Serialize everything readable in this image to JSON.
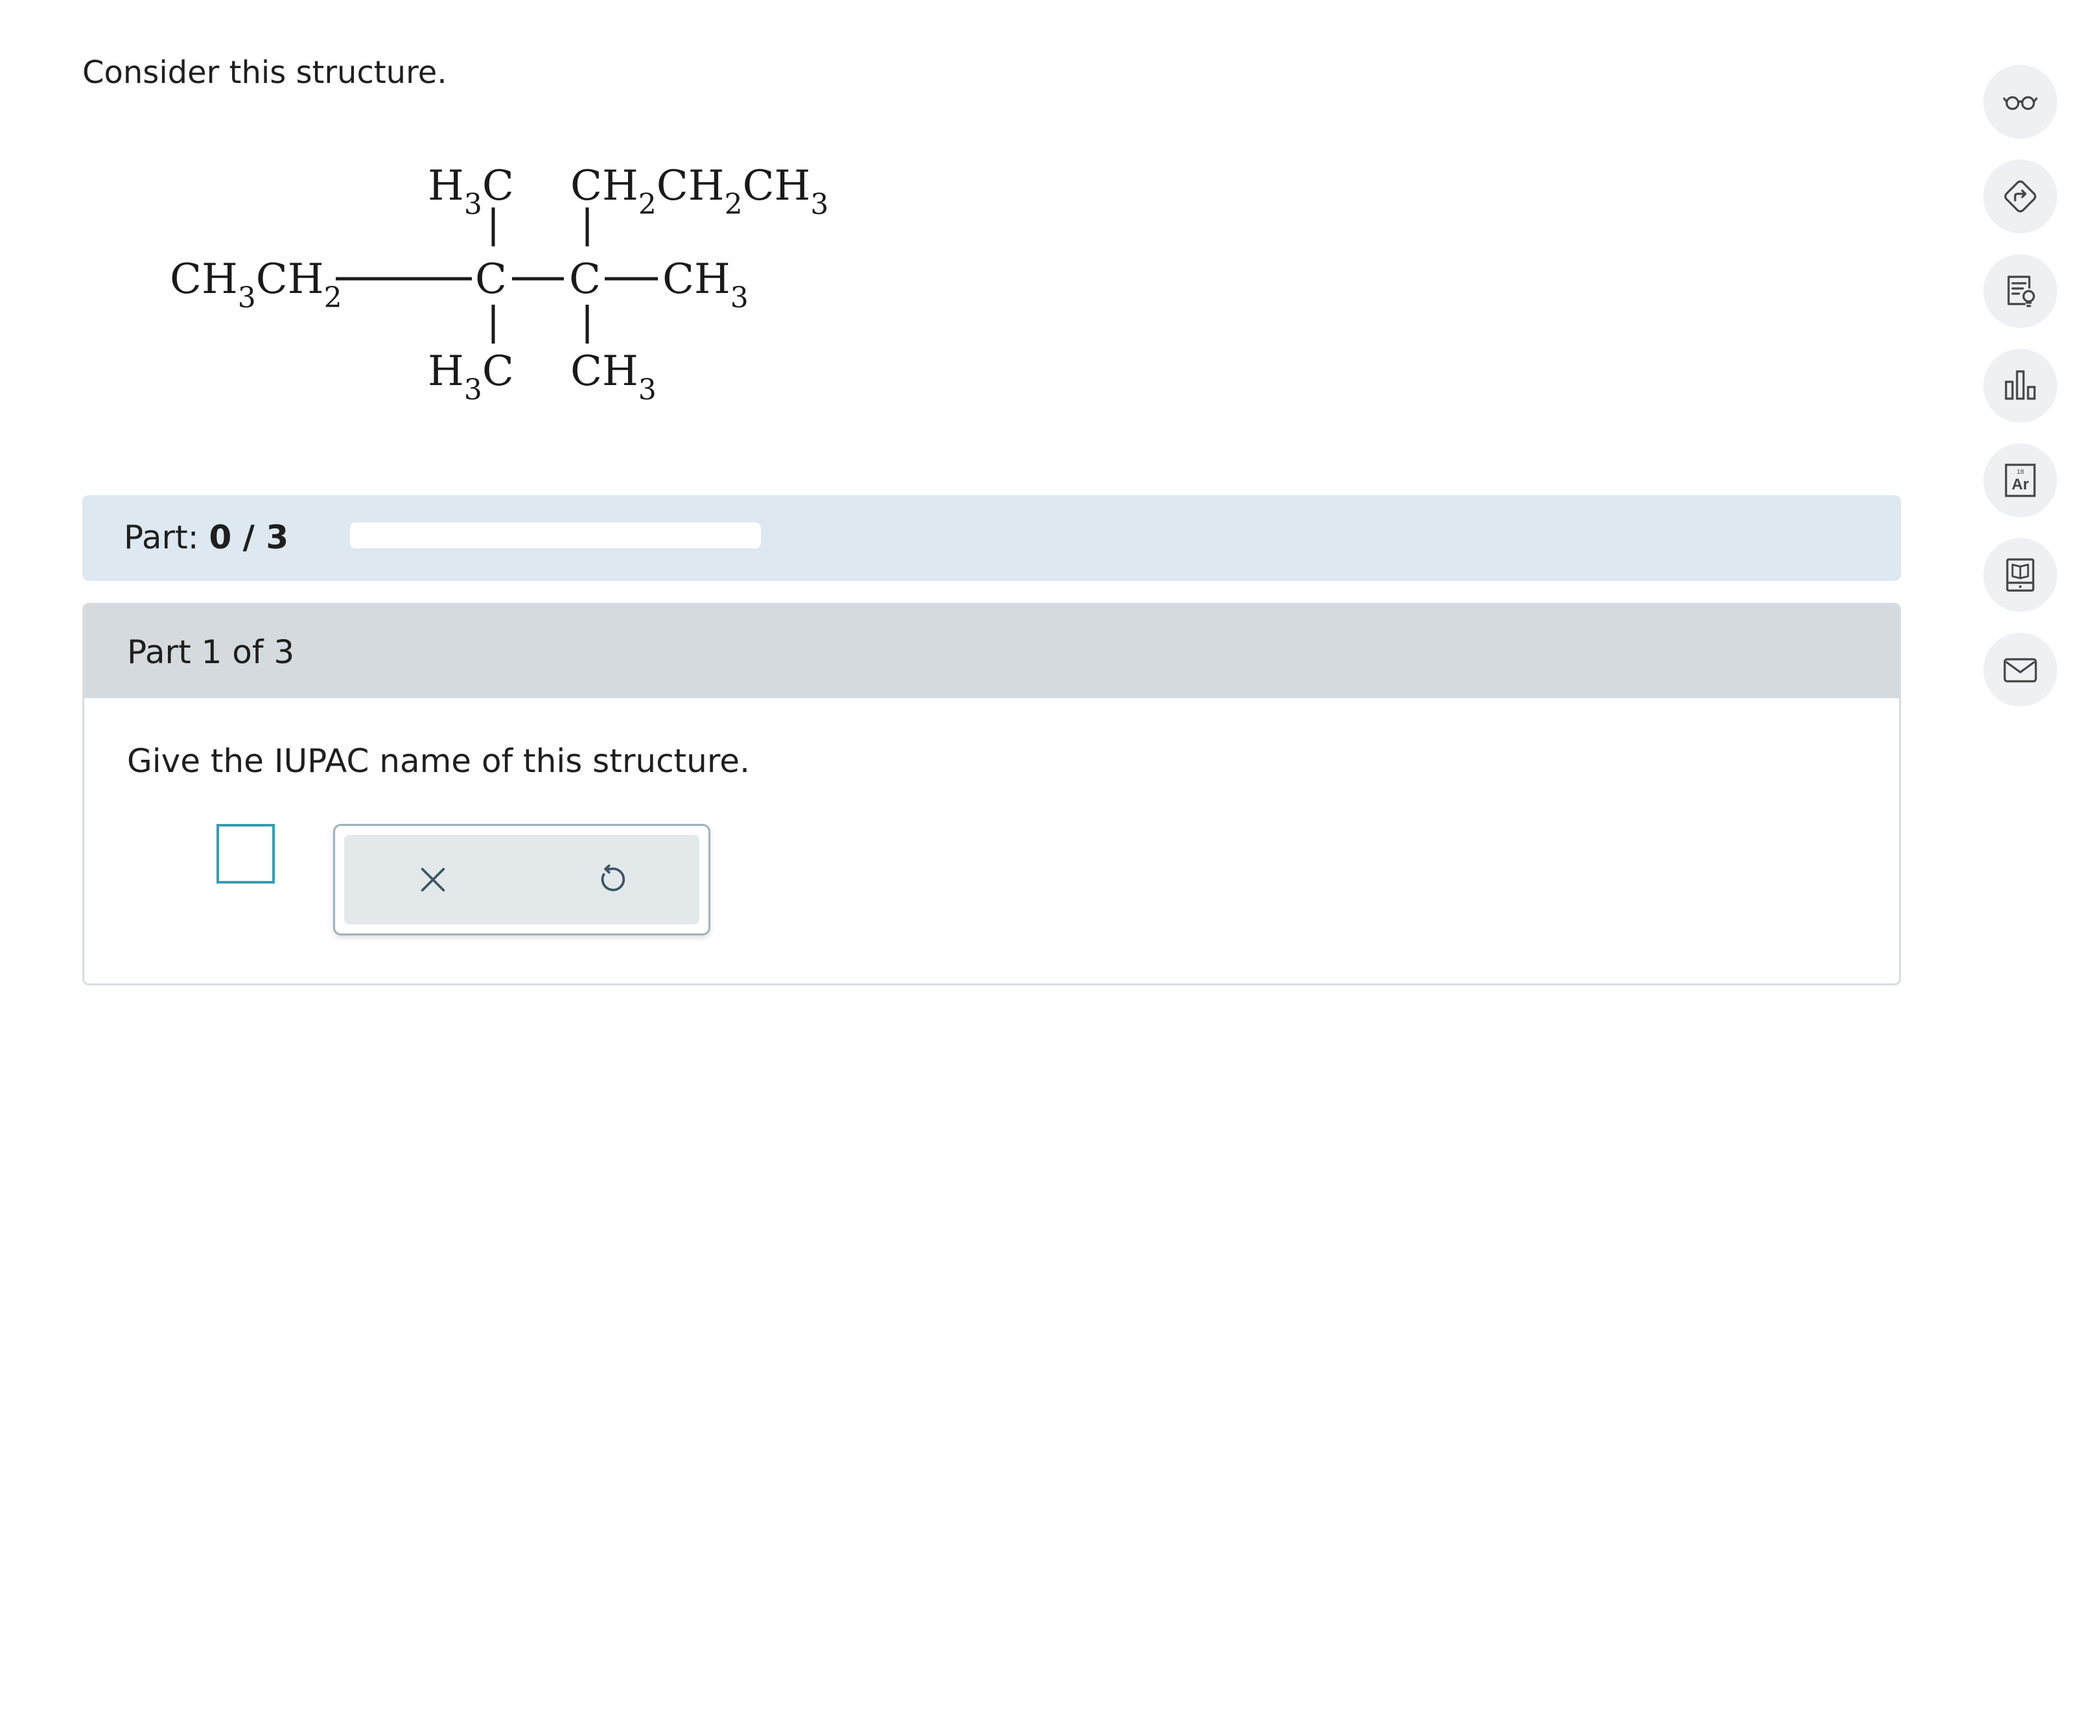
{
  "prompt": "Consider this structure.",
  "structure": {
    "left_group": {
      "t1": "CH",
      "s1": "3",
      "t2": "CH",
      "s2": "2"
    },
    "top_left": {
      "t1": "H",
      "s1": "3",
      "t2": "C"
    },
    "top_right": {
      "t1": "CH",
      "s1": "2",
      "t2": "CH",
      "s2": "2",
      "t3": "CH",
      "s3": "3"
    },
    "center_c1": "C",
    "center_c2": "C",
    "right_group": {
      "t1": "CH",
      "s1": "3"
    },
    "bottom_left": {
      "t1": "H",
      "s1": "3",
      "t2": "C"
    },
    "bottom_right": {
      "t1": "CH",
      "s1": "3"
    }
  },
  "progress": {
    "label": "Part:",
    "value": "0 / 3",
    "fraction": 0
  },
  "part": {
    "header": "Part 1 of 3",
    "question": "Give the IUPAC name of this structure."
  },
  "tools": {
    "clear_icon": "x-icon",
    "undo_icon": "undo-icon"
  },
  "sidebar": {
    "items": [
      {
        "icon": "glasses-icon"
      },
      {
        "icon": "direction-sign-icon"
      },
      {
        "icon": "checklist-lightbulb-icon"
      },
      {
        "icon": "bar-chart-icon"
      },
      {
        "icon": "periodic-element-icon",
        "number": "18",
        "symbol": "Ar"
      },
      {
        "icon": "textbook-icon"
      },
      {
        "icon": "envelope-icon"
      }
    ]
  },
  "colors": {
    "part_bar": "#dde8f1",
    "part_header": "#d4dadd",
    "answer_border": "#3a9bb0",
    "tool_bg": "#e3e8eb"
  }
}
